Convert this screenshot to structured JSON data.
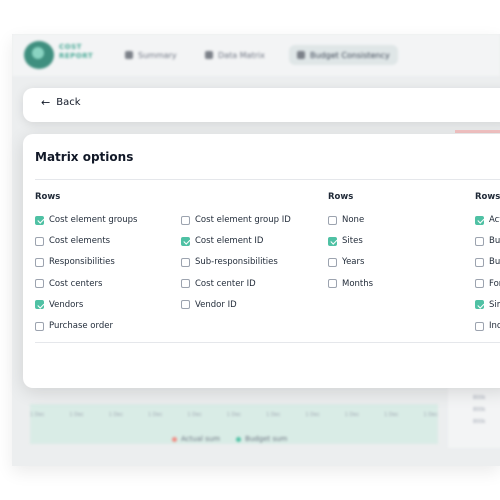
{
  "app": {
    "logo_text": [
      "COST",
      "REPORT"
    ],
    "nav": [
      {
        "label": "Summary",
        "icon": "summary-icon",
        "active": false
      },
      {
        "label": "Data Matrix",
        "icon": "table-icon",
        "active": false
      },
      {
        "label": "Budget Consistency",
        "icon": "grid-icon",
        "active": true
      }
    ]
  },
  "back": {
    "label": "Back",
    "icon": "arrow-left-icon"
  },
  "matrix": {
    "title": "Matrix options",
    "columns": [
      {
        "heading": "Rows",
        "items": [
          {
            "label": "Cost element groups",
            "checked": true
          },
          {
            "label": "Cost elements",
            "checked": false
          },
          {
            "label": "Responsibilities",
            "checked": false
          },
          {
            "label": "Cost centers",
            "checked": false
          },
          {
            "label": "Vendors",
            "checked": true
          },
          {
            "label": "Purchase order",
            "checked": false
          }
        ]
      },
      {
        "heading": "",
        "items": [
          {
            "label": "Cost element group ID",
            "checked": false
          },
          {
            "label": "Cost element ID",
            "checked": true
          },
          {
            "label": "Sub-responsibilities",
            "checked": false
          },
          {
            "label": "Cost center ID",
            "checked": false
          },
          {
            "label": "Vendor ID",
            "checked": false
          }
        ]
      },
      {
        "heading": "Rows",
        "items": [
          {
            "label": "None",
            "checked": false
          },
          {
            "label": "Sites",
            "checked": true
          },
          {
            "label": "Years",
            "checked": false
          },
          {
            "label": "Months",
            "checked": false
          }
        ]
      },
      {
        "heading": "Rows",
        "items": [
          {
            "label": "Act",
            "checked": true
          },
          {
            "label": "Bud",
            "checked": false
          },
          {
            "label": "Bud",
            "checked": false
          },
          {
            "label": "For",
            "checked": false
          },
          {
            "label": "Sim",
            "checked": true
          },
          {
            "label": "Inc",
            "checked": false
          }
        ]
      }
    ]
  },
  "chart_bg": {
    "x_ticks": [
      "1 Dec",
      "1 Dec",
      "1 Dec",
      "1 Dec",
      "1 Dec",
      "1 Dec",
      "1 Dec",
      "1 Dec",
      "1 Dec",
      "1 Dec",
      "1 Dec"
    ],
    "legend": [
      {
        "label": "Actual sum",
        "color": "#f28b82"
      },
      {
        "label": "Budget sum",
        "color": "#4fc1a4"
      }
    ],
    "right_ticks": [
      "800k",
      "800k",
      "800k"
    ]
  },
  "colors": {
    "accent": "#4fc1a4",
    "danger_strip": "#f3c3c3"
  }
}
